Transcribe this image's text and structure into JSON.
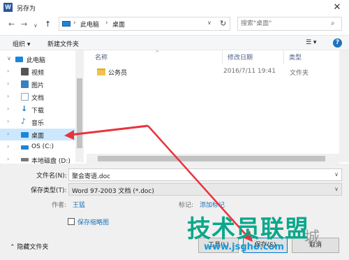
{
  "window": {
    "app_icon_letter": "W",
    "title": "另存为",
    "close_glyph": "✕"
  },
  "nav": {
    "back_glyph": "←",
    "forward_glyph": "→",
    "recent_glyph": "∨",
    "up_glyph": "↑",
    "address": {
      "separator": "›",
      "crumbs": [
        "此电脑",
        "桌面"
      ],
      "dropdown_glyph": "∨"
    },
    "refresh_glyph": "↻",
    "search": {
      "placeholder": "搜索\"桌面\"",
      "icon_glyph": "⌕"
    }
  },
  "toolbar": {
    "organize_label": "组织 ▾",
    "new_folder_label": "新建文件夹",
    "view_glyph": "☰ ▾",
    "help_glyph": "?"
  },
  "sidebar": {
    "items": [
      {
        "label": "此电脑",
        "arrow": "∨",
        "icon": "computer-icon",
        "color": "#1a86d9"
      },
      {
        "label": "视频",
        "arrow": "›",
        "icon": "video-folder-icon",
        "color": "#555555"
      },
      {
        "label": "图片",
        "arrow": "›",
        "icon": "pictures-folder-icon",
        "color": "#3a7fbf"
      },
      {
        "label": "文档",
        "arrow": "›",
        "icon": "documents-folder-icon",
        "color": "#8aa4c0"
      },
      {
        "label": "下载",
        "arrow": "›",
        "icon": "download-icon",
        "color": "#1e73be"
      },
      {
        "label": "音乐",
        "arrow": "›",
        "icon": "music-icon",
        "color": "#1e73be"
      },
      {
        "label": "桌面",
        "arrow": "›",
        "icon": "desktop-icon",
        "color": "#1a86d9"
      },
      {
        "label": "OS (C:)",
        "arrow": "›",
        "icon": "drive-c-icon",
        "color": "#1a86d9"
      },
      {
        "label": "本地磁盘 (D:)",
        "arrow": "›",
        "icon": "drive-d-icon",
        "color": "#777777"
      }
    ]
  },
  "filelist": {
    "columns": {
      "name": "名称",
      "date": "修改日期",
      "type": "类型"
    },
    "rows": [
      {
        "name": "公务员",
        "date": "2016/7/11 19:41",
        "type": "文件夹"
      }
    ]
  },
  "save": {
    "filename_label": "文件名(N):",
    "filename_value": "聚会寄语.doc",
    "filetype_label": "保存类型(T):",
    "filetype_value": "Word 97-2003 文档 (*.doc)",
    "dropdown_glyph": "∨",
    "author_label": "作者:",
    "author_value": "王猛",
    "tags_label": "标记:",
    "tags_value": "添加标记",
    "thumbnail_label": "保存缩略图",
    "hide_folders_label": "隐藏文件夹",
    "hide_folders_glyph": "⌃",
    "tools_label": "工具(L)",
    "save_label": "保存(S)",
    "cancel_label": "取消"
  },
  "watermark": {
    "text": "技术员联盟",
    "url": "www.jsgho.com",
    "ghost": "城"
  },
  "colors": {
    "selection": "#cce8ff",
    "arrow_red": "#e8333c",
    "link_blue": "#1e73be"
  }
}
